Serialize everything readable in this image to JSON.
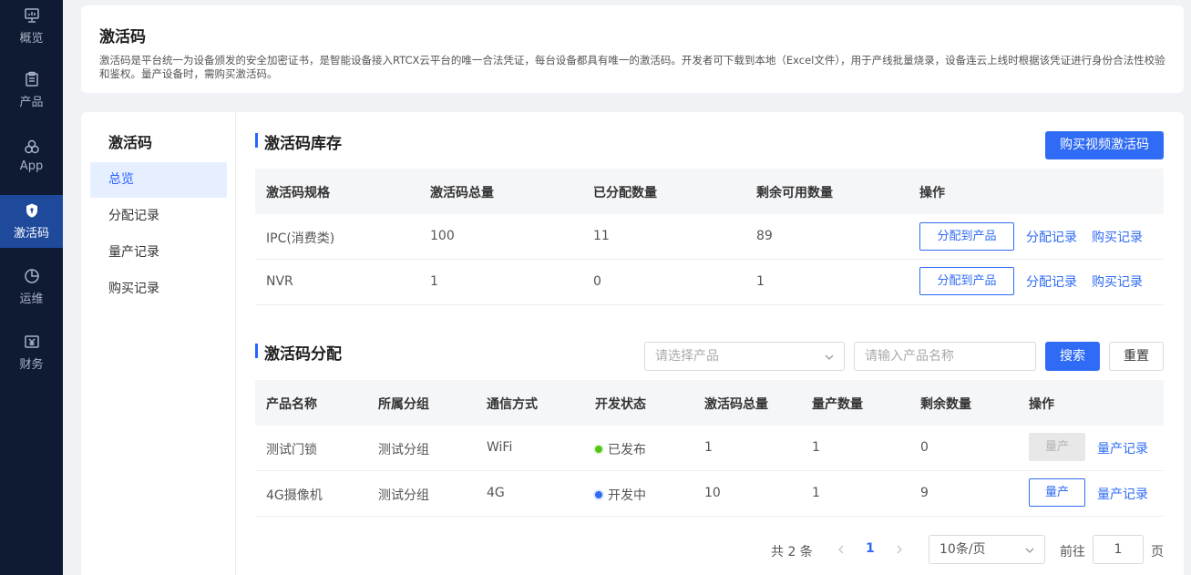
{
  "sidebar": {
    "items": [
      {
        "label": "概览",
        "icon": "monitor-icon"
      },
      {
        "label": "产品",
        "icon": "clipboard-icon"
      },
      {
        "label": "App",
        "icon": "circles-icon"
      },
      {
        "label": "激活码",
        "icon": "shield-icon"
      },
      {
        "label": "运维",
        "icon": "pie-icon"
      },
      {
        "label": "财务",
        "icon": "yen-icon"
      }
    ],
    "active_index": 3
  },
  "intro": {
    "title": "激活码",
    "description": "激活码是平台统一为设备颁发的安全加密证书，是智能设备接入RTCX云平台的唯一合法凭证，每台设备都具有唯一的激活码。开发者可下载到本地（Excel文件），用于产线批量烧录，设备连云上线时根据该凭证进行身份合法性校验和鉴权。量产设备时，需购买激活码。"
  },
  "subnav": {
    "title": "激活码",
    "items": [
      "总览",
      "分配记录",
      "量产记录",
      "购买记录"
    ],
    "active_index": 0
  },
  "inventory": {
    "title": "激活码库存",
    "buy_button": "购买视频激活码",
    "headers": [
      "激活码规格",
      "激活码总量",
      "已分配数量",
      "剩余可用数量",
      "操作"
    ],
    "rows": [
      {
        "spec": "IPC(消费类)",
        "total": "100",
        "assigned": "11",
        "remaining": "89",
        "assign_btn": "分配到产品",
        "assign_log": "分配记录",
        "buy_log": "购买记录"
      },
      {
        "spec": "NVR",
        "total": "1",
        "assigned": "0",
        "remaining": "1",
        "assign_btn": "分配到产品",
        "assign_log": "分配记录",
        "buy_log": "购买记录"
      }
    ]
  },
  "distribution": {
    "title": "激活码分配",
    "product_select_placeholder": "请选择产品",
    "name_input_placeholder": "请输入产品名称",
    "search_button": "搜索",
    "reset_button": "重置",
    "headers": [
      "产品名称",
      "所属分组",
      "通信方式",
      "开发状态",
      "激活码总量",
      "量产数量",
      "剩余数量",
      "操作"
    ],
    "rows": [
      {
        "name": "测试门锁",
        "group": "测试分组",
        "comm": "WiFi",
        "status": "已发布",
        "status_color": "#52c41a",
        "total": "1",
        "produced": "1",
        "remaining": "0",
        "produce_btn": "量产",
        "produce_enabled": false,
        "produce_log": "量产记录"
      },
      {
        "name": "4G摄像机",
        "group": "测试分组",
        "comm": "4G",
        "status": "开发中",
        "status_color": "#2f6bf4",
        "total": "10",
        "produced": "1",
        "remaining": "9",
        "produce_btn": "量产",
        "produce_enabled": true,
        "produce_log": "量产记录"
      }
    ]
  },
  "pagination": {
    "total_text": "共 2 条",
    "current_page": "1",
    "page_size": "10条/页",
    "goto_label": "前往",
    "goto_value": "1",
    "page_suffix": "页"
  },
  "colors": {
    "accent": "#2f6bf4",
    "sidebar_bg": "#0f1b33",
    "sidebar_active": "#1f4a9c"
  }
}
